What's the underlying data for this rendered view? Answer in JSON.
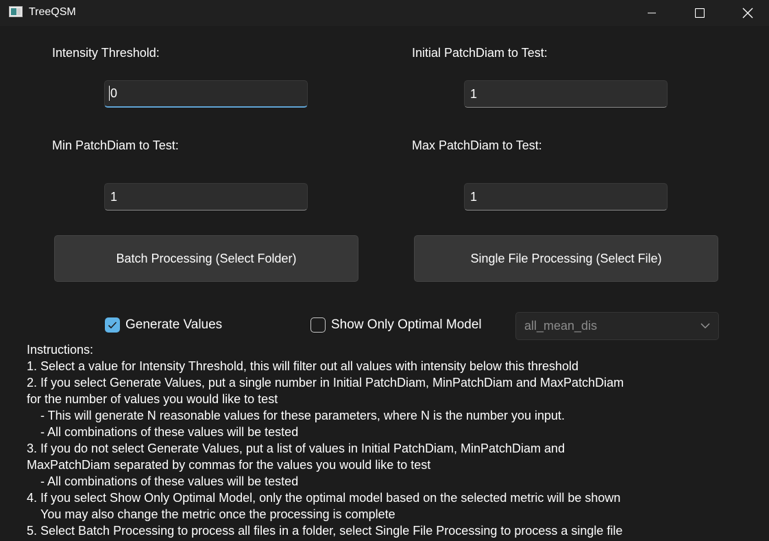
{
  "window": {
    "title": "TreeQSM"
  },
  "fields": {
    "intensity": {
      "label": "Intensity Threshold:",
      "value": "0"
    },
    "initial": {
      "label": "Initial PatchDiam to Test:",
      "value": "1"
    },
    "min": {
      "label": "Min PatchDiam to Test:",
      "value": "1"
    },
    "max": {
      "label": "Max PatchDiam to Test:",
      "value": "1"
    }
  },
  "buttons": {
    "batch": "Batch Processing (Select Folder)",
    "single": "Single File Processing (Select File)"
  },
  "options": {
    "generate_values": {
      "label": "Generate Values",
      "checked": true
    },
    "optimal_model": {
      "label": "Show Only Optimal Model",
      "checked": false
    },
    "metric": {
      "selected": "all_mean_dis"
    }
  },
  "instructions": {
    "heading": "Instructions:",
    "line1": "1. Select a value for Intensity Threshold, this will filter out all values with intensity below this threshold",
    "line2": "2. If you select Generate Values, put a single number in Initial PatchDiam, MinPatchDiam and MaxPatchDiam",
    "line3": "for the number of values you would like to test",
    "line4": "- This will generate N reasonable values for these parameters, where N is the number you input.",
    "line5": "- All combinations of these values will be tested",
    "line6": "3. If you do not select Generate Values, put a list of values in Initial PatchDiam, MinPatchDiam and",
    "line7": "MaxPatchDiam separated by commas for the values you would like to test",
    "line8": "- All combinations of these values will be tested",
    "line9": "4. If you select Show Only Optimal Model, only the optimal model based on the selected metric will be shown",
    "line10": "You may also change the metric once the processing is complete",
    "line11": "5. Select Batch Processing to process all files in a folder, select Single File Processing to process a single file"
  }
}
